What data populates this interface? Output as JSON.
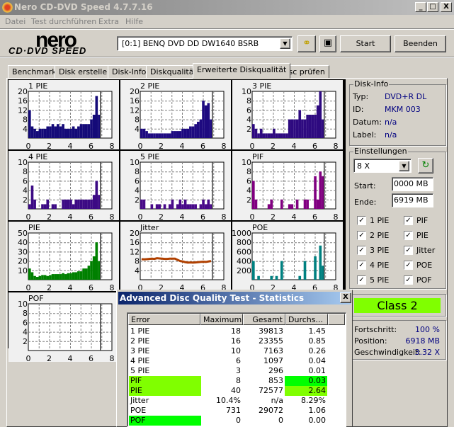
{
  "window": {
    "title": "Nero CD-DVD Speed 4.7.7.16",
    "min": "_",
    "max": "□",
    "close": "X"
  },
  "menu": [
    "Datei",
    "Test durchführen",
    "Extra",
    "Hilfe"
  ],
  "logo": {
    "line1": "nero",
    "line2": "CD·DVD SPEED"
  },
  "toolbar": {
    "drive": "[0:1]  BENQ DVD DD DW1640 BSRB",
    "start": "Start",
    "exit": "Beenden"
  },
  "tabs": [
    "Benchmark",
    "Disk erstellen",
    "Disk-Info",
    "Diskqualität",
    "Erweiterte Diskqualität",
    "Disc prüfen"
  ],
  "active_tab": 4,
  "disk_info": {
    "title": "Disk-Info",
    "rows": [
      {
        "label": "Typ:",
        "value": "DVD+R DL"
      },
      {
        "label": "ID:",
        "value": "MKM 003"
      },
      {
        "label": "Datum:",
        "value": "n/a"
      },
      {
        "label": "Label:",
        "value": "n/a"
      }
    ]
  },
  "settings": {
    "title": "Einstellungen",
    "speed": "8 X",
    "start_label": "Start:",
    "start": "0000 MB",
    "end_label": "Ende:",
    "end": "6919 MB",
    "checks_left": [
      "1 PIE",
      "2 PIE",
      "3 PIE",
      "4 PIE",
      "5 PIE"
    ],
    "checks_right": [
      "PIF",
      "PIE",
      "Jitter",
      "POE",
      "POF"
    ]
  },
  "class": {
    "label": "Class 2",
    "color": "#80ff00"
  },
  "progress": {
    "rows": [
      {
        "label": "Fortschritt:",
        "value": "100 %"
      },
      {
        "label": "Position:",
        "value": "6918 MB"
      },
      {
        "label": "Geschwindigkeit:",
        "value": "3.32 X"
      }
    ]
  },
  "dialog": {
    "title": "Advanced Disc Quality Test - Statistics",
    "close": "X",
    "headers": [
      "Error",
      "Maximum",
      "Gesamt",
      "Durchs..."
    ],
    "rows": [
      {
        "error": "1 PIE",
        "max": "18",
        "total": "39813",
        "avg": "1.45"
      },
      {
        "error": "2 PIE",
        "max": "16",
        "total": "23355",
        "avg": "0.85"
      },
      {
        "error": "3 PIE",
        "max": "10",
        "total": "7163",
        "avg": "0.26"
      },
      {
        "error": "4 PIE",
        "max": "6",
        "total": "1097",
        "avg": "0.04"
      },
      {
        "error": "5 PIE",
        "max": "3",
        "total": "296",
        "avg": "0.01"
      },
      {
        "error": "PIF",
        "max": "8",
        "total": "853",
        "avg": "0.03",
        "hl_max": "#80ff00",
        "hl_avg": "#00ff00"
      },
      {
        "error": "PIE",
        "max": "40",
        "total": "72577",
        "avg": "2.64",
        "hl_max": "#80ff00",
        "hl_avg": "#80ff00"
      },
      {
        "error": "Jitter",
        "max": "10.4%",
        "total": "n/a",
        "avg": "8.29%"
      },
      {
        "error": "POE",
        "max": "731",
        "total": "29072",
        "avg": "1.06"
      },
      {
        "error": "POF",
        "max": "0",
        "total": "0",
        "avg": "0.00",
        "hl_max": "#00ff00"
      }
    ]
  },
  "chart_data": [
    {
      "title": "1 PIE",
      "type": "bar",
      "color": "#140a78",
      "xlim": [
        0,
        8
      ],
      "ylim": [
        0,
        20
      ],
      "yticks": [
        4,
        8,
        12,
        16,
        20
      ],
      "xticks": [
        0,
        2,
        4,
        6,
        8
      ],
      "end": 6.9,
      "values": [
        12,
        5,
        4,
        3,
        4,
        4,
        4,
        5,
        5,
        6,
        5,
        6,
        5,
        6,
        4,
        4,
        4,
        5,
        4,
        5,
        6,
        6,
        6,
        6,
        8,
        10,
        18,
        10
      ]
    },
    {
      "title": "2 PIE",
      "type": "bar",
      "color": "#1e0a80",
      "xlim": [
        0,
        8
      ],
      "ylim": [
        0,
        20
      ],
      "yticks": [
        4,
        8,
        12,
        16,
        20
      ],
      "xticks": [
        0,
        2,
        4,
        6,
        8
      ],
      "end": 6.9,
      "values": [
        4,
        4,
        3,
        2,
        2,
        2,
        2,
        2,
        2,
        2,
        2,
        2,
        3,
        3,
        3,
        3,
        4,
        4,
        4,
        5,
        5,
        6,
        7,
        8,
        16,
        14,
        15,
        8
      ]
    },
    {
      "title": "3 PIE",
      "type": "bar",
      "color": "#2e0a80",
      "xlim": [
        0,
        8
      ],
      "ylim": [
        0,
        10
      ],
      "yticks": [
        2,
        4,
        6,
        8,
        10
      ],
      "xticks": [
        0,
        2,
        4,
        6,
        8
      ],
      "end": 6.9,
      "values": [
        3,
        2,
        1,
        2,
        1,
        1,
        1,
        1,
        2,
        1,
        1,
        1,
        1,
        1,
        4,
        4,
        4,
        4,
        6,
        4,
        4,
        5,
        5,
        5,
        5,
        7,
        10,
        4
      ]
    },
    {
      "title": "4 PIE",
      "type": "bar",
      "color": "#3c0a84",
      "xlim": [
        0,
        8
      ],
      "ylim": [
        0,
        10
      ],
      "yticks": [
        2,
        4,
        6,
        8,
        10
      ],
      "xticks": [
        0,
        2,
        4,
        6,
        8
      ],
      "end": 6.9,
      "values": [
        1,
        5,
        2,
        0,
        0,
        1,
        1,
        2,
        0,
        1,
        1,
        0,
        0,
        2,
        2,
        2,
        2,
        1,
        2,
        2,
        2,
        2,
        2,
        2,
        2,
        3,
        6,
        3
      ]
    },
    {
      "title": "5 PIE",
      "type": "bar",
      "color": "#480a88",
      "xlim": [
        0,
        8
      ],
      "ylim": [
        0,
        10
      ],
      "yticks": [
        2,
        4,
        6,
        8,
        10
      ],
      "xticks": [
        0,
        2,
        4,
        6,
        8
      ],
      "end": 6.9,
      "values": [
        2,
        2,
        0,
        0,
        1,
        0,
        1,
        1,
        0,
        1,
        0,
        1,
        2,
        0,
        1,
        2,
        1,
        2,
        1,
        1,
        1,
        1,
        0,
        1,
        2,
        1,
        2,
        1
      ]
    },
    {
      "title": "PIF",
      "type": "bar",
      "color": "#800080",
      "xlim": [
        0,
        8
      ],
      "ylim": [
        0,
        10
      ],
      "yticks": [
        2,
        4,
        6,
        8,
        10
      ],
      "xticks": [
        0,
        2,
        4,
        6,
        8
      ],
      "end": 6.9,
      "values": [
        6,
        2,
        0,
        0,
        0,
        0,
        1,
        2,
        0,
        0,
        0,
        2,
        0,
        0,
        1,
        1,
        0,
        2,
        0,
        0,
        2,
        2,
        0,
        0,
        7,
        2,
        8,
        7
      ]
    },
    {
      "title": "PIE",
      "type": "bar",
      "color": "#008000",
      "xlim": [
        0,
        8
      ],
      "ylim": [
        0,
        50
      ],
      "yticks": [
        10,
        20,
        30,
        40,
        50
      ],
      "xticks": [
        0,
        2,
        4,
        6,
        8
      ],
      "end": 6.9,
      "values": [
        12,
        8,
        4,
        3,
        4,
        5,
        5,
        4,
        5,
        6,
        6,
        6,
        6,
        7,
        6,
        7,
        7,
        8,
        8,
        9,
        9,
        12,
        12,
        15,
        20,
        25,
        40,
        20
      ]
    },
    {
      "title": "Jitter",
      "type": "line",
      "color": "#b04000",
      "xlim": [
        0,
        8
      ],
      "ylim": [
        0,
        20
      ],
      "yticks": [
        4,
        8,
        12,
        16,
        20
      ],
      "xticks": [
        0,
        2,
        4,
        6,
        8
      ],
      "end": 6.9,
      "values": [
        8.8,
        8.7,
        8.8,
        8.9,
        9.0,
        8.9,
        9.2,
        9.1,
        9.0,
        8.9,
        8.9,
        9.0,
        9.0,
        9.0,
        8.5,
        8.0,
        7.8,
        7.5,
        7.3,
        7.4,
        7.3,
        7.4,
        7.5,
        7.6,
        7.7,
        7.6,
        7.8,
        8.0
      ]
    },
    {
      "title": "POE",
      "type": "bar",
      "color": "#008080",
      "xlim": [
        0,
        8
      ],
      "ylim": [
        0,
        1000
      ],
      "yticks": [
        200,
        400,
        600,
        800,
        1000
      ],
      "xticks": [
        0,
        2,
        4,
        6,
        8
      ],
      "end": 6.9,
      "values": [
        400,
        0,
        80,
        0,
        0,
        0,
        0,
        80,
        0,
        80,
        0,
        400,
        0,
        0,
        0,
        0,
        0,
        0,
        80,
        0,
        400,
        0,
        0,
        0,
        500,
        0,
        731,
        300
      ]
    },
    {
      "title": "POF",
      "type": "bar",
      "color": "#c00000",
      "xlim": [
        0,
        8
      ],
      "ylim": [
        0,
        10
      ],
      "yticks": [
        2,
        4,
        6,
        8,
        10
      ],
      "xticks": [
        0,
        2,
        4,
        6,
        8
      ],
      "end": 6.9,
      "values": [
        0,
        0,
        0,
        0,
        0,
        0,
        0,
        0,
        0,
        0,
        0,
        0,
        0,
        0,
        0,
        0,
        0,
        0,
        0,
        0,
        0,
        0,
        0,
        0,
        0,
        0,
        0,
        0
      ]
    }
  ]
}
